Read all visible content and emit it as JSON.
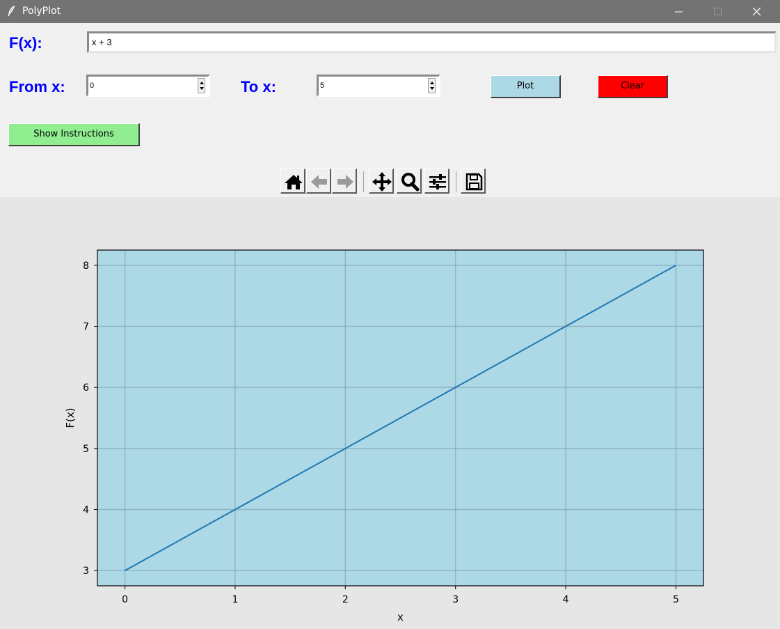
{
  "window": {
    "title": "PolyPlot",
    "icon": "feather-icon",
    "controls": [
      "minimize-icon",
      "maximize-icon",
      "close-icon"
    ]
  },
  "form": {
    "fx_label": "F(x):",
    "fx_value": "x + 3",
    "from_label": "From x:",
    "from_value": "0",
    "to_label": "To x:",
    "to_value": "5"
  },
  "buttons": {
    "plot": "Plot",
    "clear": "Clear",
    "instructions": "Show Instructions"
  },
  "colors": {
    "label_blue": "#0000ff",
    "plot_button": "#add8e6",
    "clear_button": "#ff0000",
    "instructions_button": "#90ee90",
    "axes_background": "#add8e6",
    "line": "#1f77b4"
  },
  "toolbar": {
    "tools": [
      "home-icon",
      "back-icon",
      "forward-icon",
      "pan-icon",
      "zoom-icon",
      "configure-subplots-icon",
      "save-icon"
    ]
  },
  "chart_data": {
    "type": "line",
    "x": [
      0,
      1,
      2,
      3,
      4,
      5
    ],
    "series": [
      {
        "values": [
          3,
          4,
          5,
          6,
          7,
          8
        ]
      }
    ],
    "xlabel": "x",
    "ylabel": "F(x)",
    "xlim": [
      -0.25,
      5.25
    ],
    "ylim": [
      2.75,
      8.25
    ],
    "xticks": [
      0,
      1,
      2,
      3,
      4,
      5
    ],
    "yticks": [
      3,
      4,
      5,
      6,
      7,
      8
    ],
    "grid": true
  }
}
